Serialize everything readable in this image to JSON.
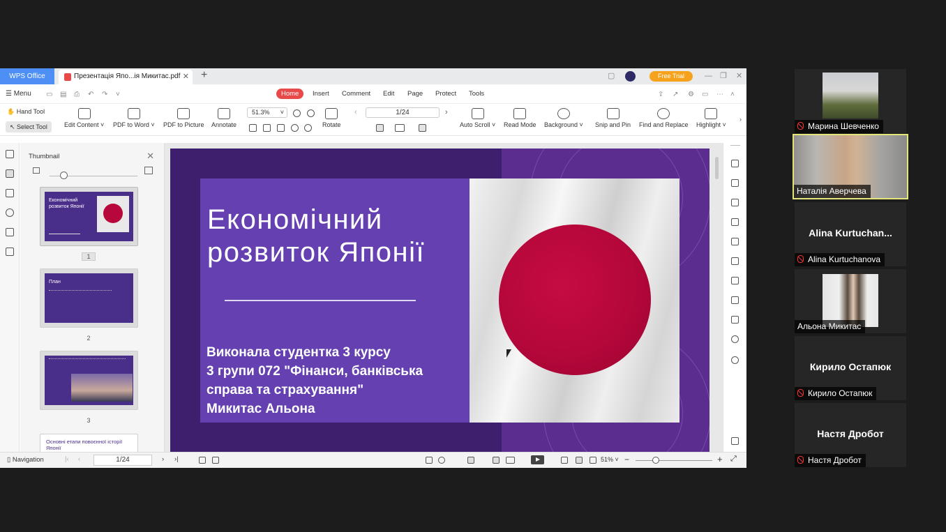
{
  "window": {
    "app_tab": "WPS Office",
    "doc_tab": "Презентація Япо...ія Микитас.pdf",
    "free_trial": "Free Trial"
  },
  "menubar": {
    "menu_label": "Menu",
    "tabs": [
      "Home",
      "Insert",
      "Comment",
      "Edit",
      "Page",
      "Protect",
      "Tools"
    ],
    "active_tab": "Home"
  },
  "ribbon": {
    "hand_tool": "Hand Tool",
    "select_tool": "Select Tool",
    "edit_content": "Edit Content ˅",
    "pdf_to_word": "PDF to Word ˅",
    "pdf_to_picture": "PDF to Picture",
    "annotate": "Annotate",
    "zoom": "51.3%",
    "rotate": "Rotate",
    "page_indicator": "1/24",
    "auto_scroll": "Auto Scroll ˅",
    "read_mode": "Read Mode",
    "background": "Background ˅",
    "snip_and_pin": "Snip and Pin",
    "find_and_replace": "Find and Replace",
    "highlight": "Highlight ˅"
  },
  "thumbnail_panel": {
    "title": "Thumbnail",
    "pages": [
      {
        "number": "1",
        "title": "Економічний розвиток Японії"
      },
      {
        "number": "2",
        "title": "План"
      },
      {
        "number": "3",
        "title": ""
      },
      {
        "number": "",
        "title": "Основні етапи повоєнної історії Японії"
      }
    ]
  },
  "slide": {
    "title_line1": "Економічний",
    "title_line2": "розвиток Японії",
    "subtitle_line1": "Виконала студентка 3 курсу",
    "subtitle_line2": "3 групи 072 \"Фінанси, банківська",
    "subtitle_line3": "справа та страхування\"",
    "subtitle_line4": "Микитас Альона"
  },
  "statusbar": {
    "navigation": "Navigation",
    "page": "1/24",
    "zoom": "51% ˅"
  },
  "participants": [
    {
      "name": "Марина Шевченко",
      "muted": true,
      "video": true
    },
    {
      "name": "Наталія Аверчева",
      "muted": false,
      "video": true,
      "active_speaker": true
    },
    {
      "display": "Alina  Kurtuchan...",
      "name": "Alina Kurtuchanova",
      "muted": true,
      "video": false
    },
    {
      "name": "Альона Микитас",
      "muted": false,
      "video": true
    },
    {
      "display": "Кирило Остапюк",
      "name": "Кирило Остапюк",
      "muted": true,
      "video": false
    },
    {
      "display": "Настя Дробот",
      "name": "Настя Дробот",
      "muted": true,
      "video": false
    }
  ],
  "colors": {
    "wps_blue": "#4d8ff5",
    "home_tab_red": "#e84a4a",
    "free_trial_orange": "#f6a21c",
    "slide_purple": "#6540b0",
    "flag_red": "#b8073a",
    "active_speaker_border": "#e3e47a"
  }
}
